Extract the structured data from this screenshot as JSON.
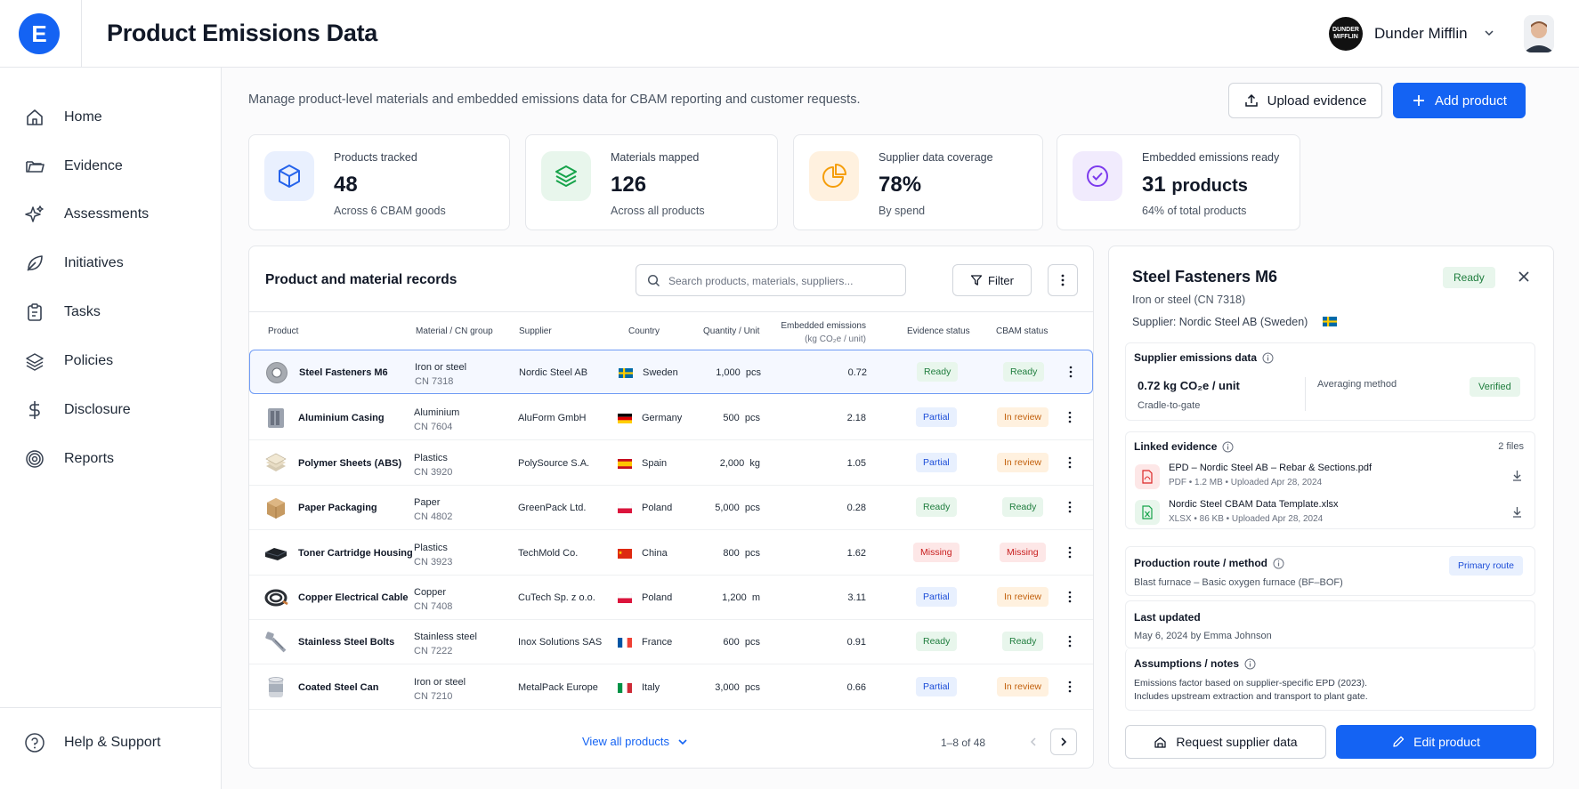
{
  "app": {
    "logo_letter": "E",
    "title": "Product Emissions Data"
  },
  "org": {
    "logo_text": "DUNDER MIFFLIN",
    "name": "Dunder Mifflin"
  },
  "sidebar": {
    "items": [
      {
        "label": "Home",
        "icon": "home-icon"
      },
      {
        "label": "Evidence",
        "icon": "folder-icon"
      },
      {
        "label": "Assessments",
        "icon": "sparkle-icon"
      },
      {
        "label": "Initiatives",
        "icon": "leaf-icon"
      },
      {
        "label": "Tasks",
        "icon": "clipboard-icon"
      },
      {
        "label": "Policies",
        "icon": "layers-icon"
      },
      {
        "label": "Disclosure",
        "icon": "dollar-icon"
      },
      {
        "label": "Reports",
        "icon": "target-icon"
      }
    ],
    "help": "Help & Support"
  },
  "header": {
    "subtitle": "Manage product-level materials and embedded emissions data for CBAM reporting and customer requests.",
    "upload_label": "Upload evidence",
    "add_label": "Add product"
  },
  "kpis": [
    {
      "label": "Products tracked",
      "value": "48",
      "unit": "",
      "sub": "Across 6 CBAM goods",
      "icon": "cube-icon",
      "color": "#2563eb"
    },
    {
      "label": "Materials mapped",
      "value": "126",
      "unit": "",
      "sub": "Across all products",
      "icon": "layers-icon",
      "color": "#16a34a"
    },
    {
      "label": "Supplier data coverage",
      "value": "78%",
      "unit": "",
      "sub": "By spend",
      "icon": "pie-chart-icon",
      "color": "#f59e0b"
    },
    {
      "label": "Embedded emissions ready",
      "value": "31",
      "unit": "products",
      "sub": "64% of total products",
      "icon": "check-circle-icon",
      "color": "#7c3aed"
    }
  ],
  "table": {
    "title": "Product and material records",
    "search_placeholder": "Search products, materials, suppliers...",
    "filter_label": "Filter",
    "headers": {
      "product": "Product",
      "material": "Material / CN group",
      "supplier": "Supplier",
      "country": "Country",
      "quantity": "Quantity / Unit",
      "emissions": "Embedded emissions",
      "emissions_unit": "(kg CO₂e / unit)",
      "evidence": "Evidence status",
      "cbam": "CBAM status"
    },
    "rows": [
      {
        "product": "Steel Fasteners M6",
        "material": "Iron or steel",
        "cn": "CN 7318",
        "supplier": "Nordic Steel AB",
        "country": "Sweden",
        "qty": "1,000",
        "unit": "pcs",
        "emissions": "0.72",
        "evidence": "Ready",
        "cbam": "Ready"
      },
      {
        "product": "Aluminium Casing",
        "material": "Aluminium",
        "cn": "CN 7604",
        "supplier": "AluForm GmbH",
        "country": "Germany",
        "qty": "500",
        "unit": "pcs",
        "emissions": "2.18",
        "evidence": "Partial",
        "cbam": "In review"
      },
      {
        "product": "Polymer Sheets (ABS)",
        "material": "Plastics",
        "cn": "CN 3920",
        "supplier": "PolySource S.A.",
        "country": "Spain",
        "qty": "2,000",
        "unit": "kg",
        "emissions": "1.05",
        "evidence": "Partial",
        "cbam": "In review"
      },
      {
        "product": "Paper Packaging",
        "material": "Paper",
        "cn": "CN 4802",
        "supplier": "GreenPack Ltd.",
        "country": "Poland",
        "qty": "5,000",
        "unit": "pcs",
        "emissions": "0.28",
        "evidence": "Ready",
        "cbam": "Ready"
      },
      {
        "product": "Toner Cartridge Housing",
        "material": "Plastics",
        "cn": "CN 3923",
        "supplier": "TechMold Co.",
        "country": "China",
        "qty": "800",
        "unit": "pcs",
        "emissions": "1.62",
        "evidence": "Missing",
        "cbam": "Missing"
      },
      {
        "product": "Copper Electrical Cable",
        "material": "Copper",
        "cn": "CN 7408",
        "supplier": "CuTech Sp. z o.o.",
        "country": "Poland",
        "qty": "1,200",
        "unit": "m",
        "emissions": "3.11",
        "evidence": "Partial",
        "cbam": "In review"
      },
      {
        "product": "Stainless Steel Bolts",
        "material": "Stainless steel",
        "cn": "CN 7222",
        "supplier": "Inox Solutions SAS",
        "country": "France",
        "qty": "600",
        "unit": "pcs",
        "emissions": "0.91",
        "evidence": "Ready",
        "cbam": "Ready"
      },
      {
        "product": "Coated Steel Can",
        "material": "Iron or steel",
        "cn": "CN 7210",
        "supplier": "MetalPack Europe",
        "country": "Italy",
        "qty": "3,000",
        "unit": "pcs",
        "emissions": "0.66",
        "evidence": "Partial",
        "cbam": "In review"
      }
    ],
    "view_all": "View all products",
    "pagination": "1–8 of 48"
  },
  "detail": {
    "title": "Steel Fasteners M6",
    "status": "Ready",
    "subtitle": "Iron or steel (CN 7318)",
    "supplier": "Supplier: Nordic Steel AB (Sweden)",
    "supplier_data": {
      "title": "Supplier emissions data",
      "value": "0.72 kg CO₂e / unit",
      "scope": "Cradle-to-gate",
      "method_label": "Averaging method",
      "verified": "Verified"
    },
    "evidence": {
      "title": "Linked evidence",
      "count": "2 files",
      "files": [
        {
          "name": "EPD – Nordic Steel AB – Rebar & Sections.pdf",
          "meta": "PDF • 1.2 MB • Uploaded Apr 28, 2024"
        },
        {
          "name": "Nordic Steel CBAM Data Template.xlsx",
          "meta": "XLSX • 86 KB • Uploaded Apr 28, 2024"
        }
      ]
    },
    "route": {
      "title": "Production route / method",
      "badge": "Primary route",
      "value": "Blast furnace – Basic oxygen furnace (BF–BOF)"
    },
    "updated": {
      "title": "Last updated",
      "value": "May 6, 2024 by Emma Johnson"
    },
    "notes": {
      "title": "Assumptions / notes",
      "line1": "Emissions factor based on supplier-specific EPD (2023).",
      "line2": "Includes upstream extraction and transport to plant gate."
    },
    "request_label": "Request supplier data",
    "edit_label": "Edit product"
  }
}
